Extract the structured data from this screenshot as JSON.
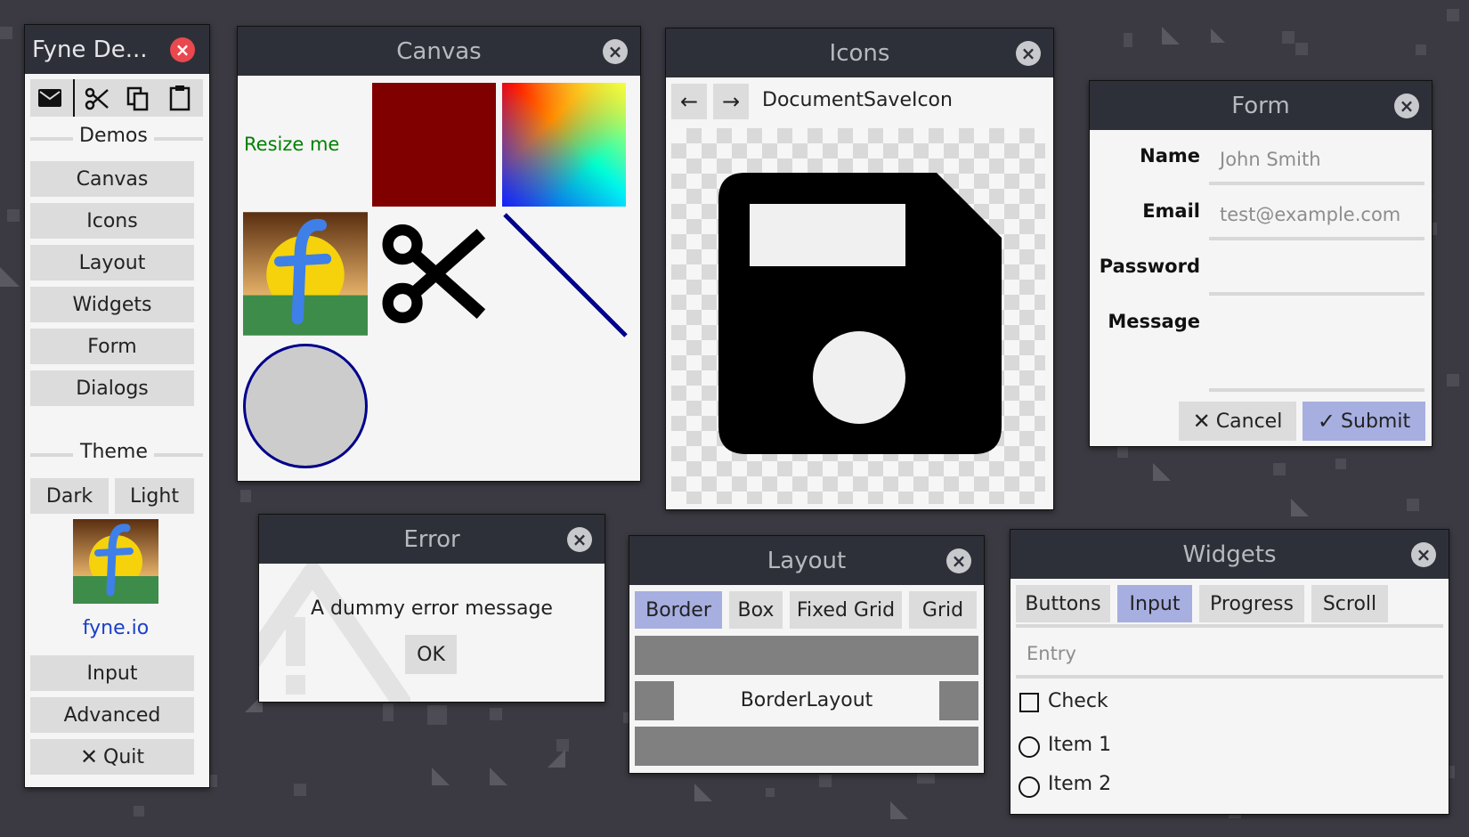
{
  "colors": {
    "desktop": "#3b3a42",
    "titlebar": "#2e3039",
    "window_bg": "#f5f5f5",
    "button": "#dcdcdc",
    "primary": "#a7aee0",
    "close_red": "#e9484f",
    "dark_red": "#800000",
    "navy": "#00008b",
    "green_text": "#008000",
    "link_blue": "#1a3fc9"
  },
  "main": {
    "title": "Fyne De...",
    "toolbar_icons": [
      "mail-icon",
      "cut-icon",
      "copy-icon",
      "paste-icon"
    ],
    "demos_heading": "Demos",
    "demo_buttons": [
      "Canvas",
      "Icons",
      "Layout",
      "Widgets",
      "Form",
      "Dialogs"
    ],
    "theme_heading": "Theme",
    "theme_dark": "Dark",
    "theme_light": "Light",
    "logo_letter": "f",
    "link": "fyne.io",
    "input_button": "Input",
    "advanced_button": "Advanced",
    "quit_button": "Quit"
  },
  "canvas": {
    "title": "Canvas",
    "resize_text": "Resize me",
    "logo_letter": "f"
  },
  "icons": {
    "title": "Icons",
    "icon_name": "DocumentSaveIcon"
  },
  "form": {
    "title": "Form",
    "name_label": "Name",
    "name_placeholder": "John Smith",
    "email_label": "Email",
    "email_placeholder": "test@example.com",
    "password_label": "Password",
    "message_label": "Message",
    "cancel": "Cancel",
    "submit": "Submit"
  },
  "error": {
    "title": "Error",
    "message": "A dummy error message",
    "ok": "OK"
  },
  "layout": {
    "title": "Layout",
    "tabs": [
      "Border",
      "Box",
      "Fixed Grid",
      "Grid"
    ],
    "selected_tab": "Border",
    "center_label": "BorderLayout"
  },
  "widgets": {
    "title": "Widgets",
    "tabs": [
      "Buttons",
      "Input",
      "Progress",
      "Scroll"
    ],
    "selected_tab": "Input",
    "entry_placeholder": "Entry",
    "check_label": "Check",
    "radio_items": [
      "Item 1",
      "Item 2"
    ]
  }
}
